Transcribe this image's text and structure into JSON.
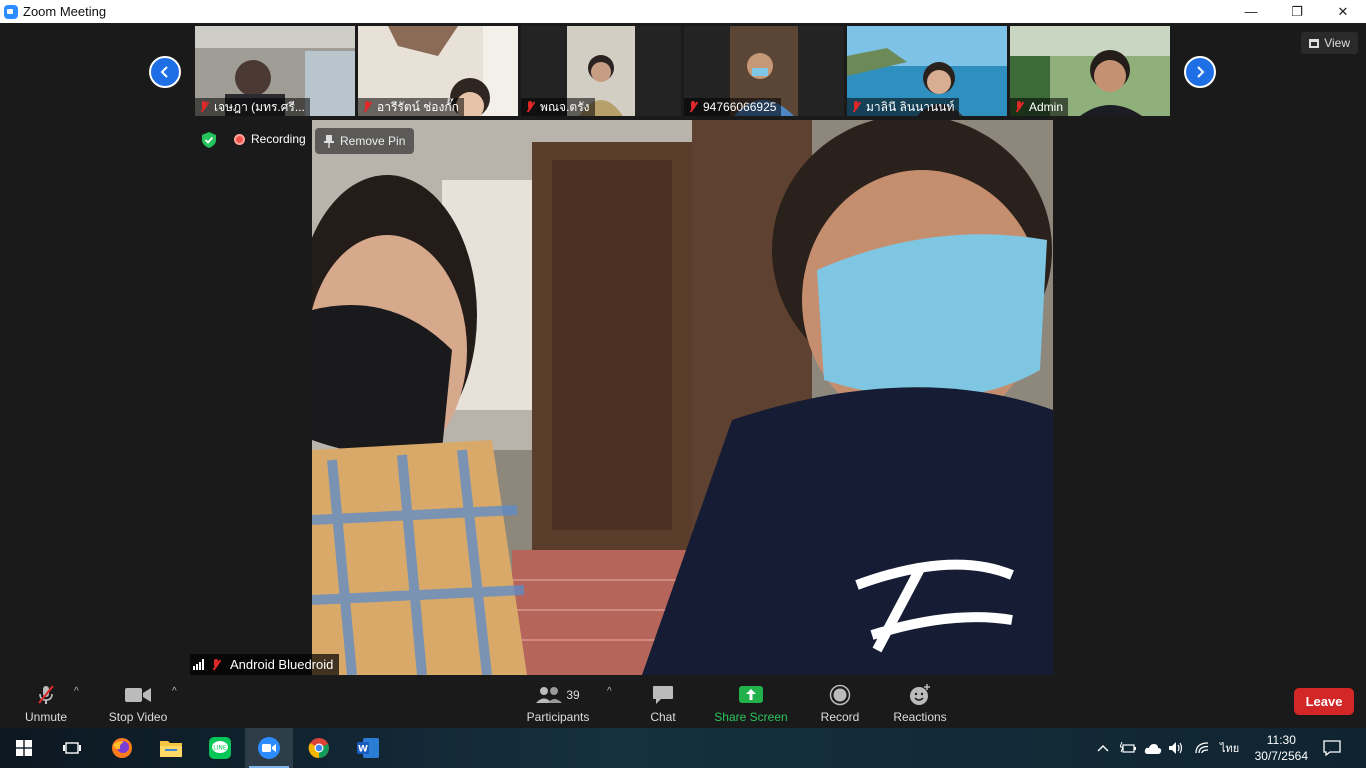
{
  "window": {
    "title": "Zoom Meeting",
    "controls": [
      "—",
      "❐",
      "✕"
    ]
  },
  "view_button": {
    "label": "View"
  },
  "thumbnails": [
    {
      "name": "เจษฎา (มทร.ศรี...",
      "bg": "#8f8d88",
      "muted": true
    },
    {
      "name": "อารีรัตน์ ช่องกั๊ก",
      "bg": "#d8d2c8",
      "muted": true
    },
    {
      "name": "พณจ.ตรัง",
      "bg": "#c5c0b4",
      "muted": true
    },
    {
      "name": "94766066925",
      "bg": "#5b4636",
      "muted": true
    },
    {
      "name": "มาลินี ลินนานนท์",
      "bg": "#5fa3c7",
      "muted": true
    },
    {
      "name": "Admin",
      "bg": "#4f6e4a",
      "muted": true
    }
  ],
  "status": {
    "recording_label": "Recording"
  },
  "pin": {
    "label": "Remove Pin"
  },
  "speaker": {
    "name": "Android Bluedroid"
  },
  "toolbar": {
    "unmute_label": "Unmute",
    "stop_video_label": "Stop Video",
    "participants_label": "Participants",
    "participants_count": "39",
    "chat_label": "Chat",
    "share_label": "Share Screen",
    "record_label": "Record",
    "reactions_label": "Reactions",
    "leave_label": "Leave"
  },
  "taskbar": {
    "apps": [
      "windows-start",
      "task-view",
      "firefox",
      "file-explorer",
      "line",
      "zoom",
      "chrome",
      "word"
    ],
    "language": "ไทย",
    "time": "11:30",
    "date": "30/7/2564"
  },
  "colors": {
    "accent_blue": "#1e6fe6",
    "share_green": "#21b24b",
    "leave_red": "#d32626",
    "muted_red": "#e02828"
  }
}
